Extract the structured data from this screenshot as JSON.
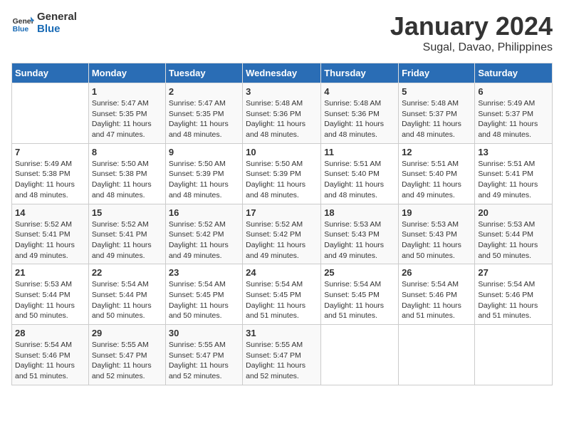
{
  "logo": {
    "line1": "General",
    "line2": "Blue"
  },
  "title": "January 2024",
  "location": "Sugal, Davao, Philippines",
  "weekdays": [
    "Sunday",
    "Monday",
    "Tuesday",
    "Wednesday",
    "Thursday",
    "Friday",
    "Saturday"
  ],
  "weeks": [
    [
      {
        "day": "",
        "info": ""
      },
      {
        "day": "1",
        "info": "Sunrise: 5:47 AM\nSunset: 5:35 PM\nDaylight: 11 hours\nand 47 minutes."
      },
      {
        "day": "2",
        "info": "Sunrise: 5:47 AM\nSunset: 5:35 PM\nDaylight: 11 hours\nand 48 minutes."
      },
      {
        "day": "3",
        "info": "Sunrise: 5:48 AM\nSunset: 5:36 PM\nDaylight: 11 hours\nand 48 minutes."
      },
      {
        "day": "4",
        "info": "Sunrise: 5:48 AM\nSunset: 5:36 PM\nDaylight: 11 hours\nand 48 minutes."
      },
      {
        "day": "5",
        "info": "Sunrise: 5:48 AM\nSunset: 5:37 PM\nDaylight: 11 hours\nand 48 minutes."
      },
      {
        "day": "6",
        "info": "Sunrise: 5:49 AM\nSunset: 5:37 PM\nDaylight: 11 hours\nand 48 minutes."
      }
    ],
    [
      {
        "day": "7",
        "info": "Sunrise: 5:49 AM\nSunset: 5:38 PM\nDaylight: 11 hours\nand 48 minutes."
      },
      {
        "day": "8",
        "info": "Sunrise: 5:50 AM\nSunset: 5:38 PM\nDaylight: 11 hours\nand 48 minutes."
      },
      {
        "day": "9",
        "info": "Sunrise: 5:50 AM\nSunset: 5:39 PM\nDaylight: 11 hours\nand 48 minutes."
      },
      {
        "day": "10",
        "info": "Sunrise: 5:50 AM\nSunset: 5:39 PM\nDaylight: 11 hours\nand 48 minutes."
      },
      {
        "day": "11",
        "info": "Sunrise: 5:51 AM\nSunset: 5:40 PM\nDaylight: 11 hours\nand 48 minutes."
      },
      {
        "day": "12",
        "info": "Sunrise: 5:51 AM\nSunset: 5:40 PM\nDaylight: 11 hours\nand 49 minutes."
      },
      {
        "day": "13",
        "info": "Sunrise: 5:51 AM\nSunset: 5:41 PM\nDaylight: 11 hours\nand 49 minutes."
      }
    ],
    [
      {
        "day": "14",
        "info": "Sunrise: 5:52 AM\nSunset: 5:41 PM\nDaylight: 11 hours\nand 49 minutes."
      },
      {
        "day": "15",
        "info": "Sunrise: 5:52 AM\nSunset: 5:41 PM\nDaylight: 11 hours\nand 49 minutes."
      },
      {
        "day": "16",
        "info": "Sunrise: 5:52 AM\nSunset: 5:42 PM\nDaylight: 11 hours\nand 49 minutes."
      },
      {
        "day": "17",
        "info": "Sunrise: 5:52 AM\nSunset: 5:42 PM\nDaylight: 11 hours\nand 49 minutes."
      },
      {
        "day": "18",
        "info": "Sunrise: 5:53 AM\nSunset: 5:43 PM\nDaylight: 11 hours\nand 49 minutes."
      },
      {
        "day": "19",
        "info": "Sunrise: 5:53 AM\nSunset: 5:43 PM\nDaylight: 11 hours\nand 50 minutes."
      },
      {
        "day": "20",
        "info": "Sunrise: 5:53 AM\nSunset: 5:44 PM\nDaylight: 11 hours\nand 50 minutes."
      }
    ],
    [
      {
        "day": "21",
        "info": "Sunrise: 5:53 AM\nSunset: 5:44 PM\nDaylight: 11 hours\nand 50 minutes."
      },
      {
        "day": "22",
        "info": "Sunrise: 5:54 AM\nSunset: 5:44 PM\nDaylight: 11 hours\nand 50 minutes."
      },
      {
        "day": "23",
        "info": "Sunrise: 5:54 AM\nSunset: 5:45 PM\nDaylight: 11 hours\nand 50 minutes."
      },
      {
        "day": "24",
        "info": "Sunrise: 5:54 AM\nSunset: 5:45 PM\nDaylight: 11 hours\nand 51 minutes."
      },
      {
        "day": "25",
        "info": "Sunrise: 5:54 AM\nSunset: 5:45 PM\nDaylight: 11 hours\nand 51 minutes."
      },
      {
        "day": "26",
        "info": "Sunrise: 5:54 AM\nSunset: 5:46 PM\nDaylight: 11 hours\nand 51 minutes."
      },
      {
        "day": "27",
        "info": "Sunrise: 5:54 AM\nSunset: 5:46 PM\nDaylight: 11 hours\nand 51 minutes."
      }
    ],
    [
      {
        "day": "28",
        "info": "Sunrise: 5:54 AM\nSunset: 5:46 PM\nDaylight: 11 hours\nand 51 minutes."
      },
      {
        "day": "29",
        "info": "Sunrise: 5:55 AM\nSunset: 5:47 PM\nDaylight: 11 hours\nand 52 minutes."
      },
      {
        "day": "30",
        "info": "Sunrise: 5:55 AM\nSunset: 5:47 PM\nDaylight: 11 hours\nand 52 minutes."
      },
      {
        "day": "31",
        "info": "Sunrise: 5:55 AM\nSunset: 5:47 PM\nDaylight: 11 hours\nand 52 minutes."
      },
      {
        "day": "",
        "info": ""
      },
      {
        "day": "",
        "info": ""
      },
      {
        "day": "",
        "info": ""
      }
    ]
  ]
}
